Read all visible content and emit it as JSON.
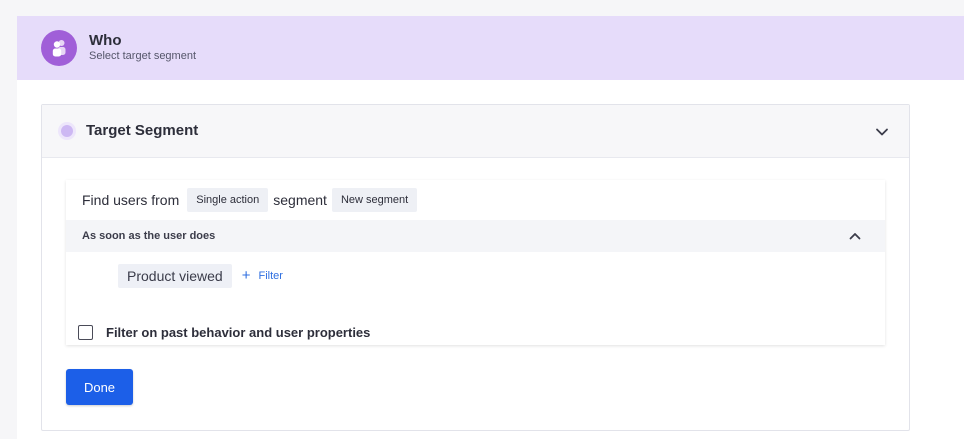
{
  "who": {
    "title": "Who",
    "subtitle": "Select target segment"
  },
  "segment_panel": {
    "title": "Target Segment"
  },
  "segment_builder": {
    "find_prefix": "Find users from",
    "segment_type_chip": "Single action",
    "segment_word": "segment",
    "segment_name_chip": "New segment",
    "as_soon_label": "As soon as the user does",
    "event_chip": "Product viewed",
    "filter_link": "Filter",
    "past_behavior_label": "Filter on past behavior and user properties",
    "past_behavior_checked": false
  },
  "actions": {
    "done_label": "Done"
  },
  "colors": {
    "header_bg": "#e6dcfa",
    "avatar": "#a05fd8",
    "primary_button": "#1c5fe8",
    "link": "#2f6fe0"
  }
}
